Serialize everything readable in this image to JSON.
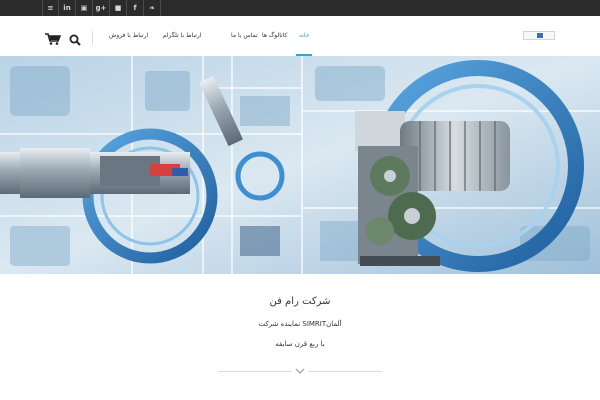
{
  "topbar": {
    "social": [
      {
        "icon": "rss-icon",
        "glyph": "≡"
      },
      {
        "icon": "linkedin-icon",
        "glyph": "in"
      },
      {
        "icon": "instagram-icon",
        "glyph": "▣"
      },
      {
        "icon": "google-plus-icon",
        "glyph": "g+"
      },
      {
        "icon": "flickr-icon",
        "glyph": "■"
      },
      {
        "icon": "facebook-icon",
        "glyph": "f"
      },
      {
        "icon": "twitter-icon",
        "glyph": "❧"
      }
    ]
  },
  "nav": {
    "home": "خانه",
    "catalogs": "کاتالوگ ها",
    "contact": "تماس با ما",
    "telegram": "ارتباط با تلگرام",
    "sales": "ارتباط با فروش"
  },
  "colors": {
    "accent": "#3aa0c8",
    "topbar": "#2b2b2b",
    "seal_blue": "#2f7fc2"
  },
  "content": {
    "title": "شرکت رام فن",
    "line1": "نماینده شرکت SIMRITآلمان",
    "line2": "با ربع قرن سابقه"
  }
}
